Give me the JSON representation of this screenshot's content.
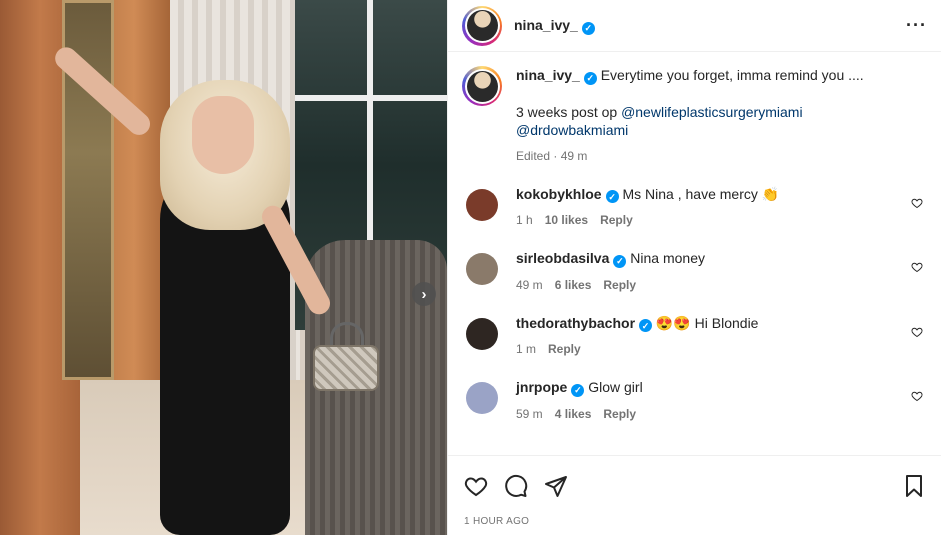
{
  "post": {
    "author": "nina_ivy_",
    "verified": true,
    "caption_text": "Everytime you forget, imma remind you ....",
    "caption_line2": "3 weeks post op",
    "mention1": "@newlifeplasticsurgerymiami",
    "mention2": "@drdowbakmiami",
    "edited_meta": "Edited · 49 m",
    "timestamp": "1 HOUR AGO"
  },
  "comments": [
    {
      "user": "kokobykhloe",
      "text": "Ms Nina , have mercy 👏",
      "time": "1 h",
      "likes": "10 likes",
      "reply": "Reply",
      "avatar_color": "#7a3b2a"
    },
    {
      "user": "sirleobdasilva",
      "text": "Nina money",
      "time": "49 m",
      "likes": "6 likes",
      "reply": "Reply",
      "avatar_color": "#8a7a6a"
    },
    {
      "user": "thedorathybachor",
      "text": "😍😍 Hi Blondie",
      "time": "1 m",
      "likes": "",
      "reply": "Reply",
      "avatar_color": "#2e2622"
    },
    {
      "user": "jnrpope",
      "text": "Glow girl",
      "time": "59 m",
      "likes": "4 likes",
      "reply": "Reply",
      "avatar_color": "#9aa3c6"
    }
  ],
  "colors": {
    "accent": "#0095f6",
    "mention": "#00376b",
    "muted": "#737373"
  },
  "icons": [
    "more-options-icon",
    "heart-icon",
    "comment-icon",
    "share-icon",
    "bookmark-icon",
    "chevron-right-icon",
    "verified-badge-icon"
  ]
}
